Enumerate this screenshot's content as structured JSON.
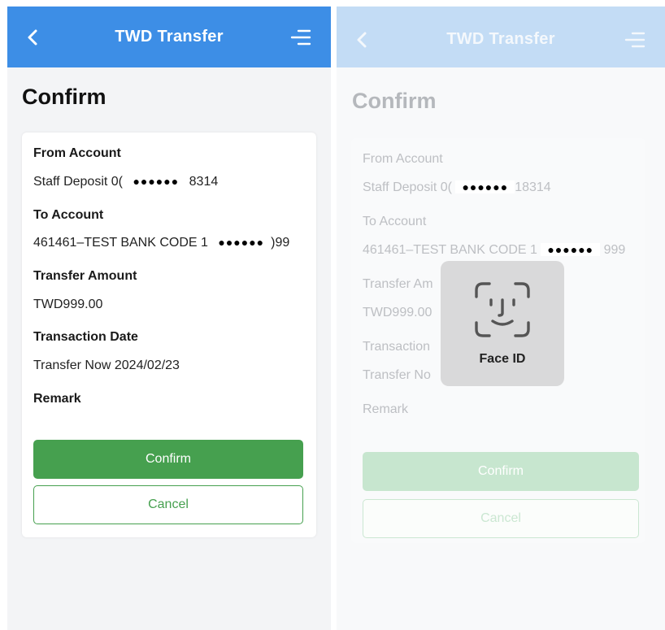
{
  "header": {
    "title": "TWD Transfer"
  },
  "page": {
    "title": "Confirm"
  },
  "fields": {
    "from_label": "From Account",
    "from_value_prefix": "Staff Deposit 0(",
    "from_mask": "●●●●●●",
    "from_value_suffix": "8314",
    "to_label": "To Account",
    "to_value_prefix": "461461–TEST BANK CODE 1",
    "to_mask": "●●●●●●",
    "to_value_suffix": ")99",
    "amount_label": "Transfer Amount",
    "amount_value": "TWD999.00",
    "date_label": "Transaction Date",
    "date_value": "Transfer Now 2024/02/23",
    "remark_label": "Remark"
  },
  "right_fields": {
    "from_value_prefix": "Staff Deposit 0(",
    "from_value_suffix": "18314",
    "to_value_prefix": "461461–TEST BANK CODE 1",
    "to_value_suffix": "999",
    "amount_label": "Transfer Am",
    "amount_value": "TWD999.00",
    "date_label": "Transaction",
    "date_value": "Transfer No"
  },
  "buttons": {
    "confirm": "Confirm",
    "cancel": "Cancel"
  },
  "faceid": {
    "label": "Face ID"
  },
  "colors": {
    "header": "#3d8ee6",
    "primary_green": "#46a04f"
  }
}
